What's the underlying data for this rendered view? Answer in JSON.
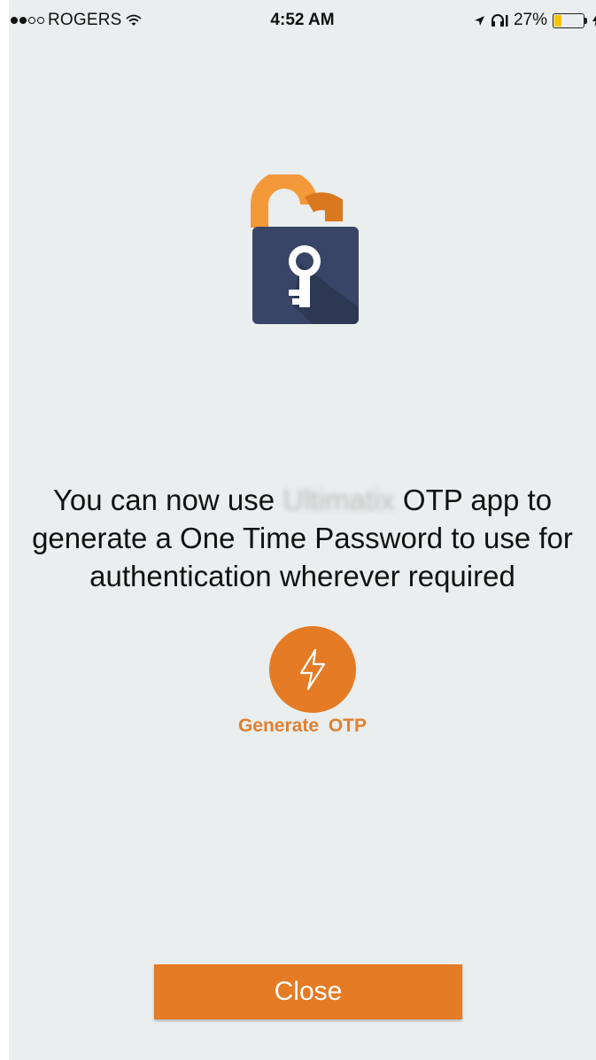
{
  "status_bar": {
    "carrier": "ROGERS",
    "time": "4:52 AM",
    "battery_percent": "27%",
    "battery_level": 0.27,
    "signal_bars_filled": 3,
    "signal_bars_total": 5
  },
  "message": {
    "before": "You can now use",
    "app_name": "Ultimatix",
    "after": "OTP app to generate a One Time Password to use for authentication wherever required"
  },
  "generate": {
    "label": "Generate OTP",
    "icon": "lightning-bolt-icon"
  },
  "close_button": {
    "label": "Close"
  },
  "colors": {
    "accent": "#e57b24",
    "background": "#eaeeee",
    "lock_body": "#33405f",
    "lock_shackle": "#e98a2c"
  }
}
